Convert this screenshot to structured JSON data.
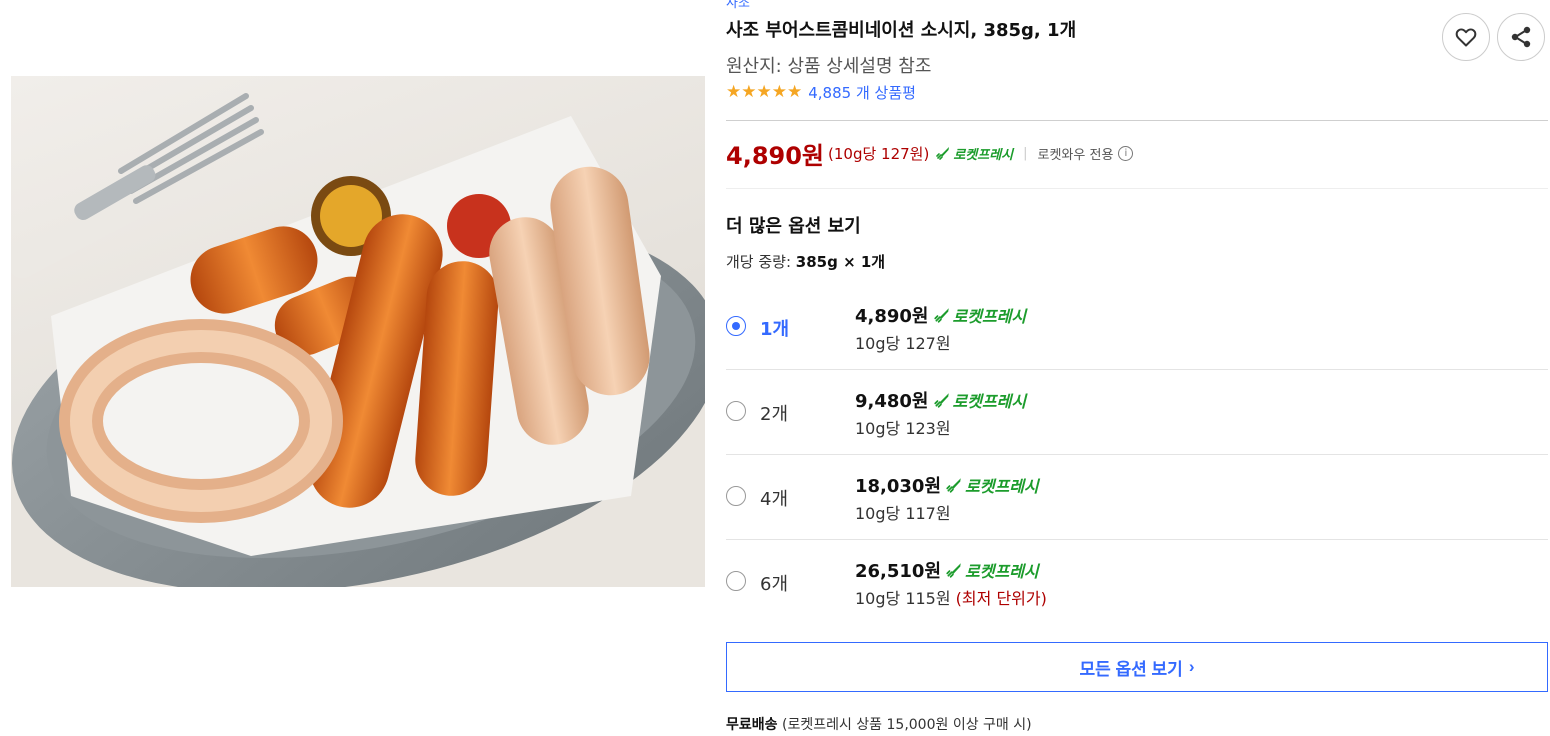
{
  "product": {
    "brand": "사조",
    "title": "사조 부어스트콤비네이션 소시지, 385g, 1개",
    "origin": "원산지: 상품 상세설명 참조",
    "rating_stars": 5,
    "review_count": "4,885 개 상품평",
    "image_alt": "sausage-platter-photo"
  },
  "price": {
    "main": "4,890원",
    "unit": "(10g당 127원)",
    "badge": "로켓프레시",
    "separator": "|",
    "wow_only": "로켓와우 전용",
    "info_icon": "i"
  },
  "options": {
    "title": "더 많은 옵션 보기",
    "weight_label": "개당 중량: ",
    "weight_value": "385g × 1개",
    "items": [
      {
        "qty": "1개",
        "price": "4,890원",
        "badge": "로켓프레시",
        "unit": "10g당 127원",
        "note": "",
        "selected": true
      },
      {
        "qty": "2개",
        "price": "9,480원",
        "badge": "로켓프레시",
        "unit": "10g당 123원",
        "note": "",
        "selected": false
      },
      {
        "qty": "4개",
        "price": "18,030원",
        "badge": "로켓프레시",
        "unit": "10g당 117원",
        "note": "",
        "selected": false
      },
      {
        "qty": "6개",
        "price": "26,510원",
        "badge": "로켓프레시",
        "unit": "10g당 115원",
        "note": " (최저 단위가)",
        "selected": false
      }
    ],
    "all_button": "모든 옵션 보기",
    "all_button_chevron": "›"
  },
  "shipping": {
    "label": "무료배송",
    "detail": " (로켓프레시 상품 15,000원 이상 구매 시)"
  },
  "colors": {
    "link_blue": "#346aff",
    "price_red": "#ae0000",
    "rocket_green": "#1c9c2c",
    "star_orange": "#f5a623"
  },
  "icons": {
    "like": "heart-icon",
    "share": "share-icon",
    "rocket": "rocket-icon",
    "info": "info-circle-icon"
  }
}
